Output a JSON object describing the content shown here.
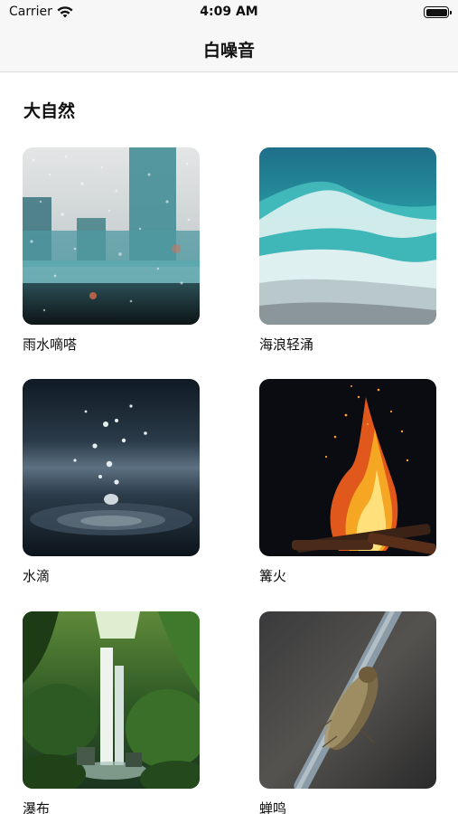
{
  "status_bar": {
    "carrier": "Carrier",
    "time": "4:09 AM",
    "wifi_icon": "wifi-icon",
    "battery_icon": "battery-icon"
  },
  "nav": {
    "title": "白噪音"
  },
  "section": {
    "title": "大自然",
    "items": [
      {
        "label": "雨水嘀嗒",
        "icon": "rain-window-image"
      },
      {
        "label": "海浪轻涌",
        "icon": "ocean-wave-image"
      },
      {
        "label": "水滴",
        "icon": "water-drop-image"
      },
      {
        "label": "篝火",
        "icon": "campfire-image"
      },
      {
        "label": "瀑布",
        "icon": "waterfall-image"
      },
      {
        "label": "蝉鸣",
        "icon": "cicada-image"
      }
    ]
  }
}
